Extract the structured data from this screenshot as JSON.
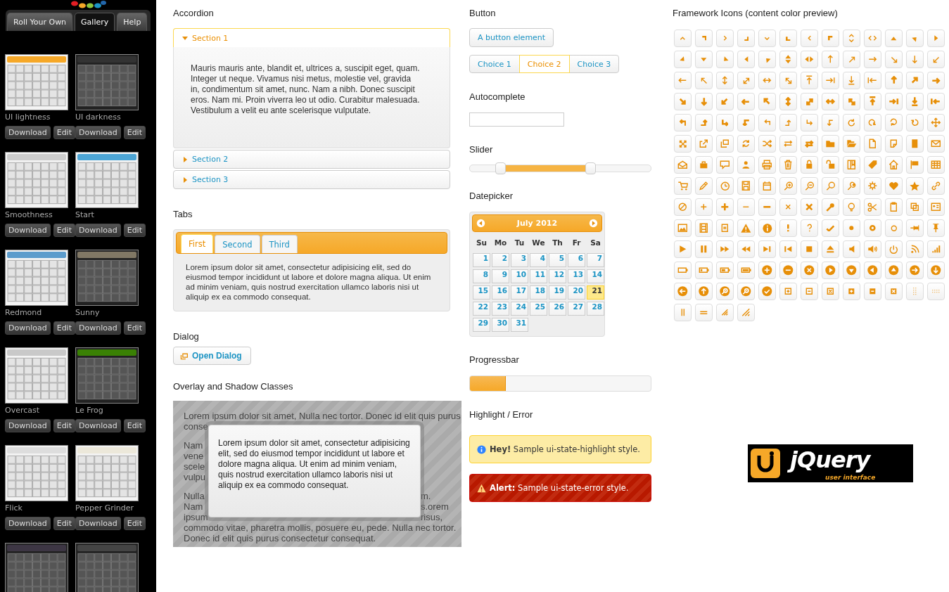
{
  "gallery": {
    "tabs": [
      {
        "label": "Roll Your Own",
        "selected": false
      },
      {
        "label": "Gallery",
        "selected": true
      },
      {
        "label": "Help",
        "selected": false
      }
    ],
    "themes": [
      {
        "name": "UI lightness",
        "color": "#f6a828",
        "buttons": [
          "Download",
          "Edit"
        ]
      },
      {
        "name": "UI darkness",
        "color": "#333333",
        "buttons": [
          "Download",
          "Edit"
        ]
      },
      {
        "name": "Smoothness",
        "color": "#cccccc",
        "buttons": [
          "Download",
          "Edit"
        ]
      },
      {
        "name": "Start",
        "color": "#4ca5d5",
        "buttons": [
          "Download",
          "Edit"
        ]
      },
      {
        "name": "Redmond",
        "color": "#5c9ccc",
        "buttons": [
          "Download",
          "Edit"
        ]
      },
      {
        "name": "Sunny",
        "color": "#817865",
        "buttons": [
          "Download",
          "Edit"
        ]
      },
      {
        "name": "Overcast",
        "color": "#c9c9c9",
        "buttons": [
          "Download",
          "Edit"
        ]
      },
      {
        "name": "Le Frog",
        "color": "#3a8104",
        "buttons": [
          "Download",
          "Edit"
        ]
      },
      {
        "name": "Flick",
        "color": "#dddddd",
        "buttons": [
          "Download",
          "Edit"
        ]
      },
      {
        "name": "Pepper Grinder",
        "color": "#ece8da",
        "buttons": [
          "Download",
          "Edit"
        ]
      },
      {
        "color": "#3d3644"
      },
      {
        "color": "#444444"
      }
    ]
  },
  "accordion": {
    "title": "Accordion",
    "sections": [
      {
        "label": "Section 1",
        "expanded": true,
        "content": "Mauris mauris ante, blandit et, ultrices a, suscipit eget, quam. Integer ut neque. Vivamus nisi metus, molestie vel, gravida in, condimentum sit amet, nunc. Nam a nibh. Donec suscipit eros. Nam mi. Proin viverra leo ut odio. Curabitur malesuada. Vestibulum a velit eu ante scelerisque vulputate."
      },
      {
        "label": "Section 2",
        "expanded": false
      },
      {
        "label": "Section 3",
        "expanded": false
      }
    ]
  },
  "tabs": {
    "title": "Tabs",
    "tabs": [
      {
        "label": "First",
        "selected": true
      },
      {
        "label": "Second",
        "selected": false
      },
      {
        "label": "Third",
        "selected": false
      }
    ],
    "content": "Lorem ipsum dolor sit amet, consectetur adipisicing elit, sed do eiusmod tempor incididunt ut labore et dolore magna aliqua. Ut enim ad minim veniam, quis nostrud exercitation ullamco laboris nisi ut aliquip ex ea commodo consequat."
  },
  "dialog": {
    "title": "Dialog",
    "button": "Open Dialog"
  },
  "overlay": {
    "title": "Overlay and Shadow Classes",
    "paragraphs": [
      [
        {
          "left": "Lorem ipsum dolor sit amet, Nulla nec tortor. Donec id elit quis purus"
        },
        {
          "left": "conse"
        }
      ],
      [
        {
          "left": "Nam"
        },
        {
          "left": "vene"
        },
        {
          "left": "scele"
        },
        {
          "left": "vulpu"
        }
      ],
      [
        {
          "left": "Nulla",
          "right": "m."
        },
        {
          "left": "Nam",
          "right": "s.orem"
        },
        {
          "left": "ipsum",
          "right": "risus,"
        },
        {
          "left": "commodo vitae, pharetra mollis, posuere eu, pede. Nulla nec tortor."
        },
        {
          "left": "Donec id elit quis purus consectetur consequat."
        }
      ]
    ],
    "dialog_text": "Lorem ipsum dolor sit amet, consectetur adipisicing elit, sed do eiusmod tempor incididunt ut labore et dolore magna aliqua. Ut enim ad minim veniam, quis nostrud exercitation ullamco laboris nisi ut aliquip ex ea commodo consequat."
  },
  "button": {
    "title": "Button",
    "button": "A button element",
    "choices": [
      {
        "label": "Choice 1",
        "selected": false
      },
      {
        "label": "Choice 2",
        "selected": true
      },
      {
        "label": "Choice 3",
        "selected": false
      }
    ]
  },
  "autocomplete": {
    "title": "Autocomplete"
  },
  "slider": {
    "title": "Slider",
    "handles": [
      {
        "level": 0.17
      },
      {
        "level": 0.67
      }
    ]
  },
  "datepicker": {
    "title": "Datepicker",
    "month": "July 2012",
    "weekdays": [
      "Su",
      "Mo",
      "Tu",
      "We",
      "Th",
      "Fr",
      "Sa"
    ],
    "days": [
      {
        "label": "1",
        "today": false
      },
      {
        "label": "2",
        "today": false
      },
      {
        "label": "3",
        "today": false
      },
      {
        "label": "4",
        "today": false
      },
      {
        "label": "5",
        "today": false
      },
      {
        "label": "6",
        "today": false
      },
      {
        "label": "7",
        "today": false
      },
      {
        "label": "8",
        "today": false
      },
      {
        "label": "9",
        "today": false
      },
      {
        "label": "10",
        "today": false
      },
      {
        "label": "11",
        "today": false
      },
      {
        "label": "12",
        "today": false
      },
      {
        "label": "13",
        "today": false
      },
      {
        "label": "14",
        "today": false
      },
      {
        "label": "15",
        "today": false
      },
      {
        "label": "16",
        "today": false
      },
      {
        "label": "17",
        "today": false
      },
      {
        "label": "18",
        "today": false
      },
      {
        "label": "19",
        "today": false
      },
      {
        "label": "20",
        "today": false
      },
      {
        "label": "21",
        "today": true
      },
      {
        "label": "22",
        "today": false
      },
      {
        "label": "23",
        "today": false
      },
      {
        "label": "24",
        "today": false
      },
      {
        "label": "25",
        "today": false
      },
      {
        "label": "26",
        "today": false
      },
      {
        "label": "27",
        "today": false
      },
      {
        "label": "28",
        "today": false
      },
      {
        "label": "29",
        "today": false
      },
      {
        "label": "30",
        "today": false
      },
      {
        "label": "31",
        "today": false
      }
    ]
  },
  "progressbar": {
    "title": "Progressbar",
    "level": 0.2
  },
  "highlight": {
    "title": "Highlight / Error",
    "messages": [
      {
        "kind": "highlight",
        "text": "**Hey!** Sample ui-state-highlight style."
      },
      {
        "kind": "error",
        "text": "**Alert:** Sample ui-state-error style."
      }
    ]
  },
  "framework_icons": {
    "title": "Framework Icons (content color preview)"
  },
  "logo": {
    "wordmark": "jQuery",
    "tagline": "user interface"
  }
}
